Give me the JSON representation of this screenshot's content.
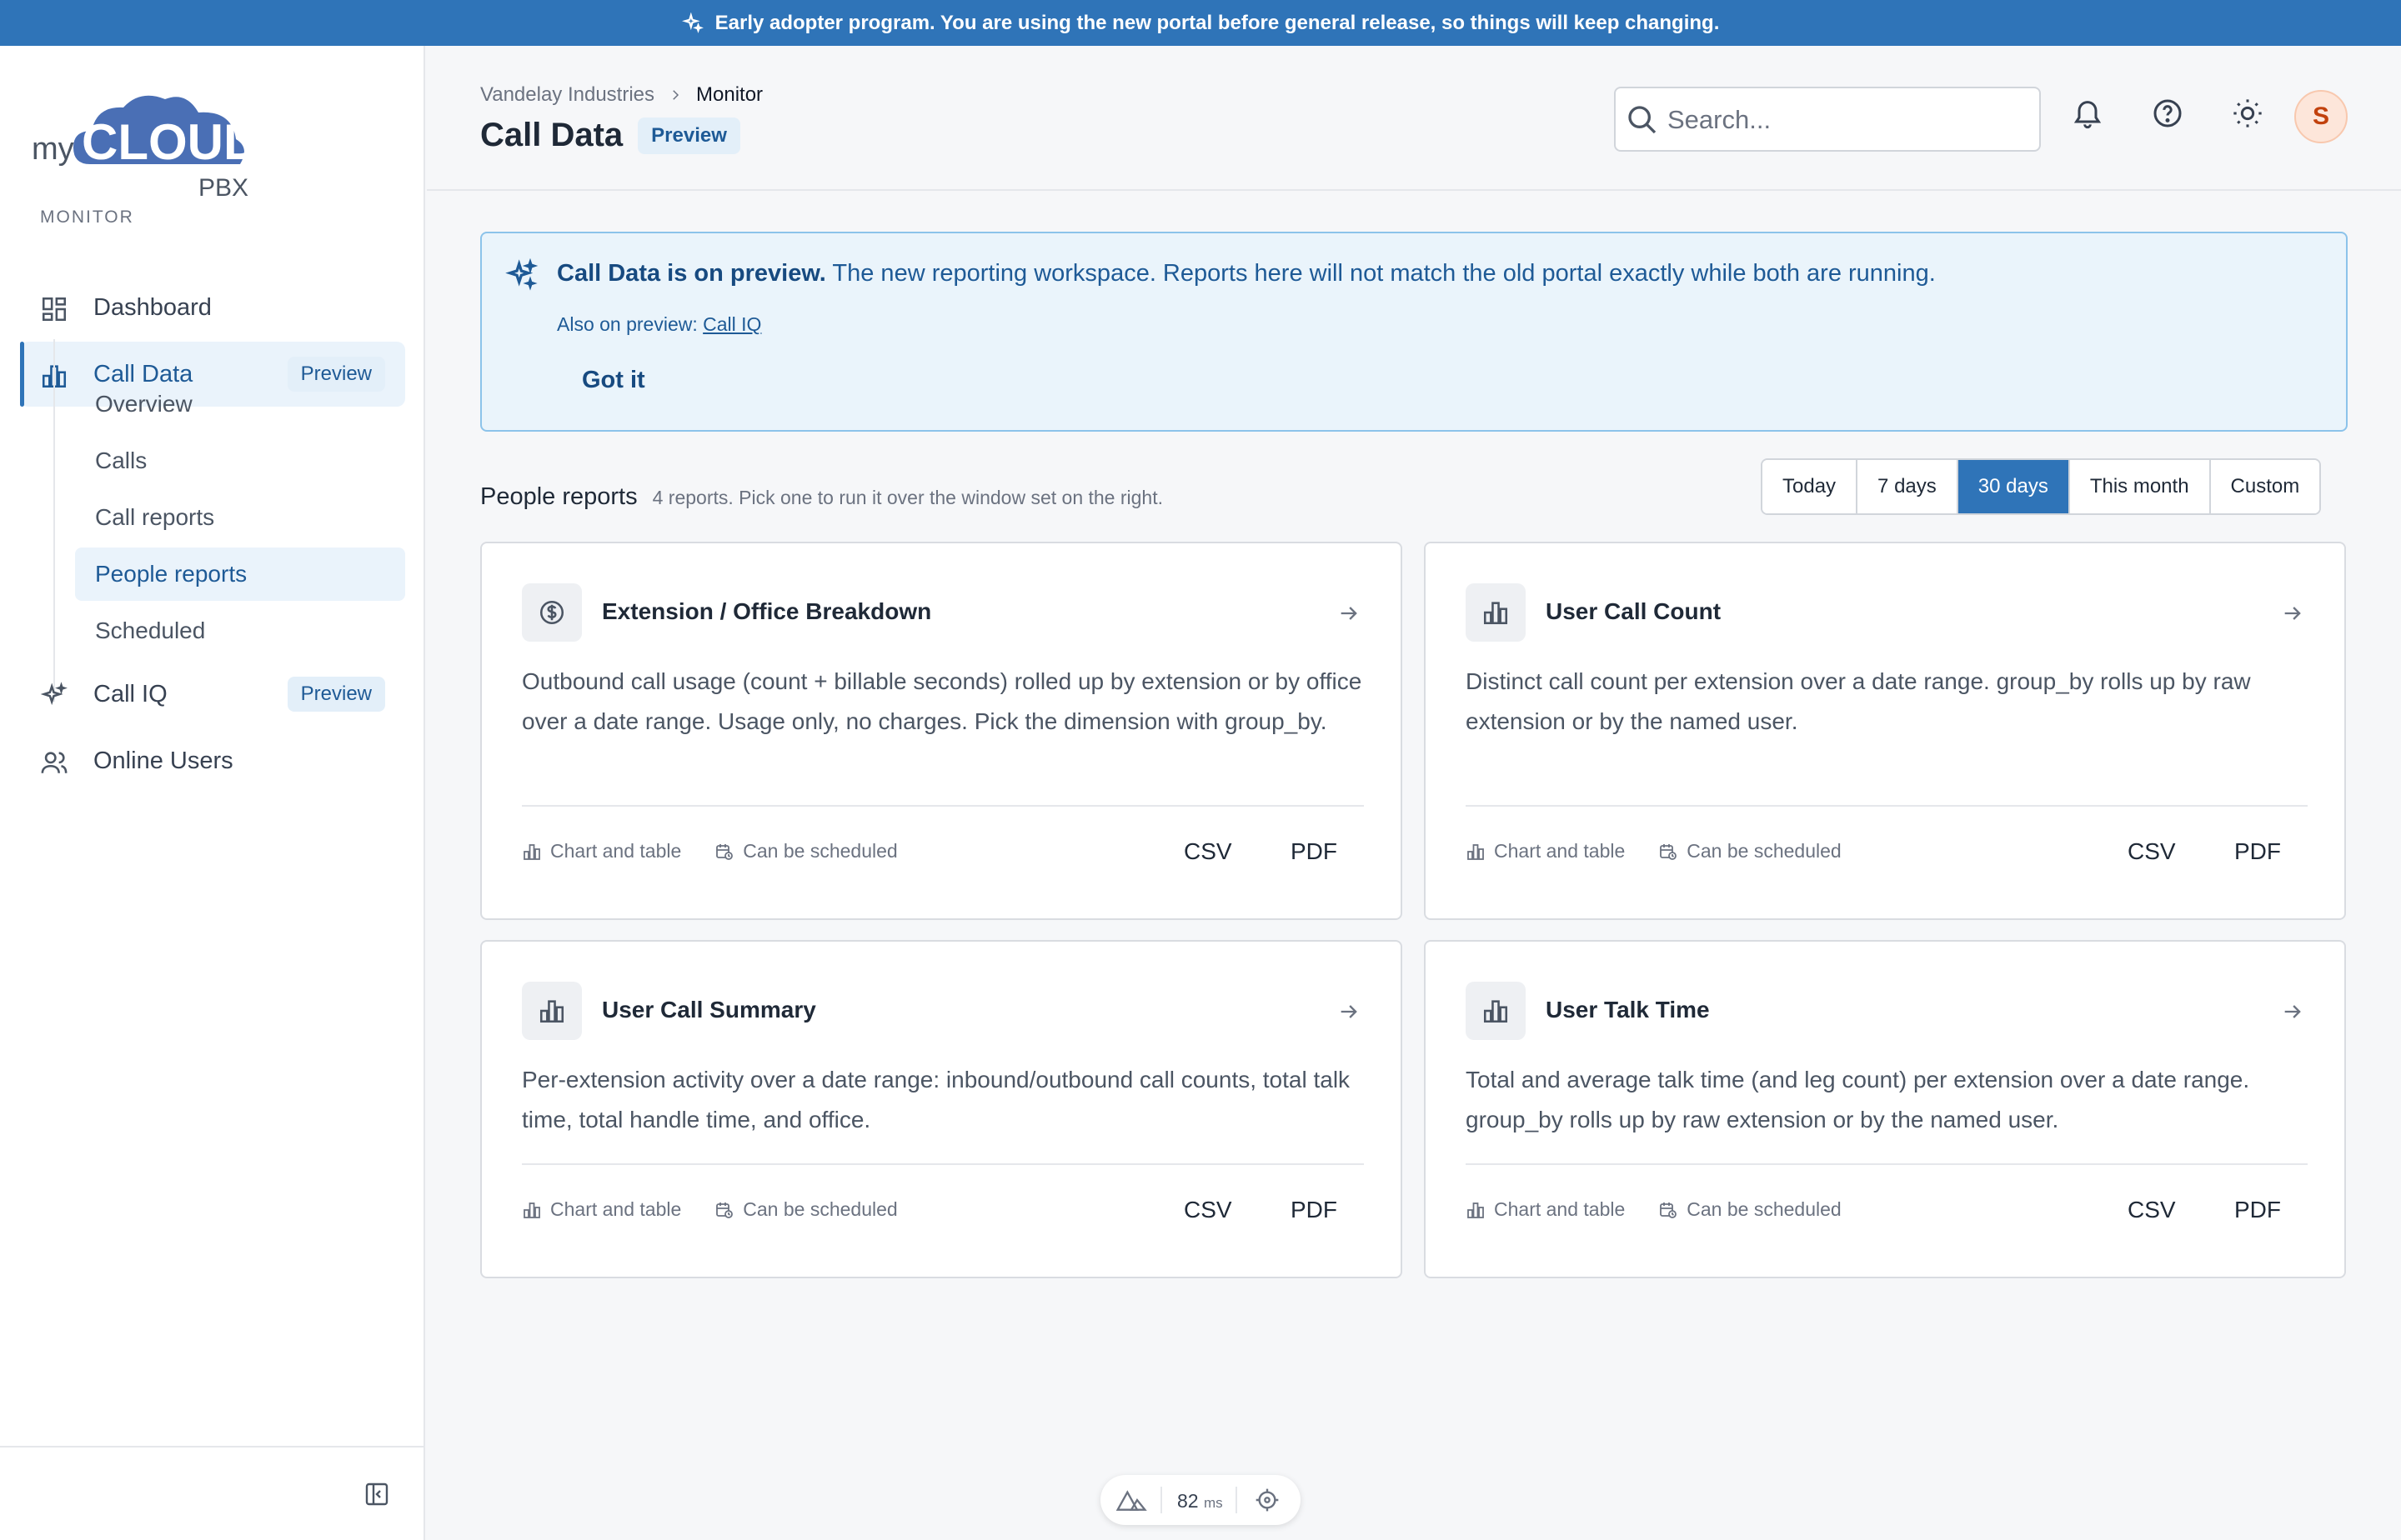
{
  "banner": {
    "text": "Early adopter program. You are using the new portal before general release, so things will keep changing."
  },
  "logo": {
    "my": "my",
    "cloud": "CLOUD",
    "pbx": "PBX"
  },
  "sidebar": {
    "section": "MONITOR",
    "items": [
      {
        "label": "Dashboard",
        "icon": "dashboard-icon"
      },
      {
        "label": "Call Data",
        "icon": "bar-chart-icon",
        "badge": "Preview"
      },
      {
        "label": "Call IQ",
        "icon": "sparkle-icon",
        "badge": "Preview"
      },
      {
        "label": "Online Users",
        "icon": "users-icon"
      }
    ],
    "sub_items": [
      "Overview",
      "Calls",
      "Call reports",
      "People reports",
      "Scheduled"
    ]
  },
  "header": {
    "breadcrumb": [
      "Vandelay Industries",
      "Monitor"
    ],
    "title": "Call Data",
    "badge": "Preview",
    "search_placeholder": "Search...",
    "avatar": "S"
  },
  "notice": {
    "bold": "Call Data is on preview.",
    "text": " The new reporting workspace. Reports here will not match the old portal exactly while both are running.",
    "also_prefix": "Also on preview: ",
    "also_link": "Call IQ",
    "button": "Got it"
  },
  "reports": {
    "title": "People reports",
    "subtitle": "4 reports. Pick one to run it over the window set on the right.",
    "ranges": [
      "Today",
      "7 days",
      "30 days",
      "This month",
      "Custom"
    ],
    "selected_range": "30 days",
    "cards": [
      {
        "title": "Extension / Office Breakdown",
        "icon": "dollar-icon",
        "desc": "Outbound call usage (count + billable seconds) rolled up by extension or by office over a date range. Usage only, no charges. Pick the dimension with group_by."
      },
      {
        "title": "User Call Count",
        "icon": "bar-chart-icon",
        "desc": "Distinct call count per extension over a date range. group_by rolls up by raw extension or by the named user."
      },
      {
        "title": "User Call Summary",
        "icon": "bar-chart-icon",
        "desc": "Per-extension activity over a date range: inbound/outbound call counts, total talk time, total handle time, and office."
      },
      {
        "title": "User Talk Time",
        "icon": "bar-chart-icon",
        "desc": "Total and average talk time (and leg count) per extension over a date range. group_by rolls up by raw extension or by the named user."
      }
    ],
    "footer": {
      "chart": "Chart and table",
      "schedule": "Can be scheduled",
      "csv": "CSV",
      "pdf": "PDF"
    }
  },
  "perf": {
    "value": "82",
    "unit": "ms"
  },
  "colors": {
    "accent": "#2f74b8",
    "banner": "#2f74b8",
    "preview_bg": "#e3eff9",
    "notice_bg": "#eaf4fb"
  }
}
